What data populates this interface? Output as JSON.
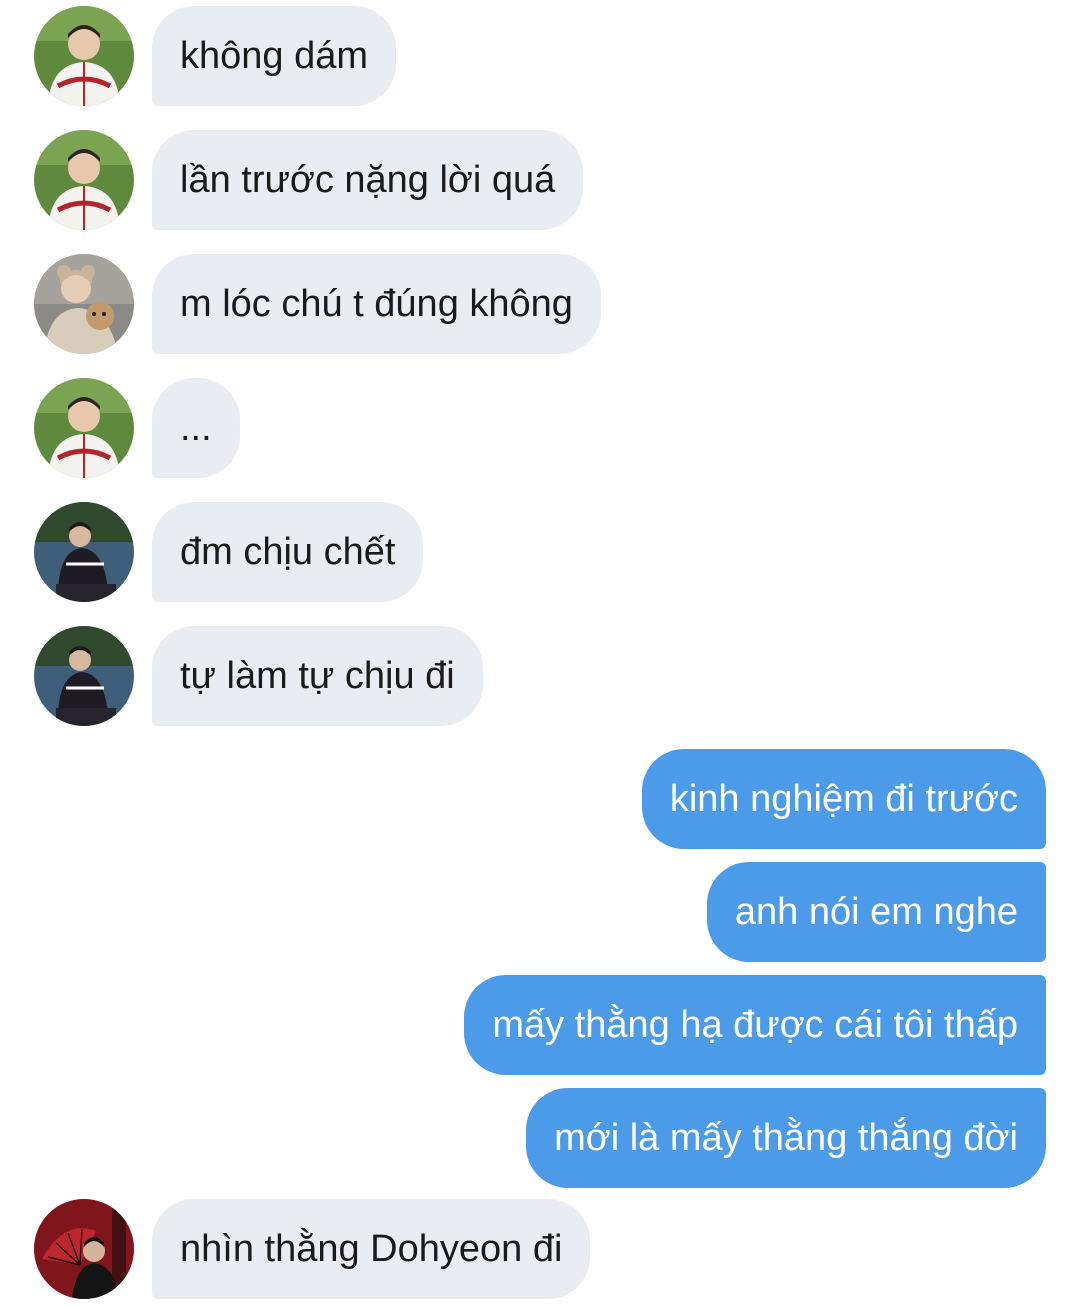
{
  "messages": [
    {
      "side": "incoming",
      "avatar": "avatar-baseball-jersey",
      "text": "không dám"
    },
    {
      "side": "incoming",
      "avatar": "avatar-baseball-jersey",
      "text": "lần trước nặng lời quá"
    },
    {
      "side": "incoming",
      "avatar": "avatar-bear-hat",
      "text": "m lóc chú t đúng không"
    },
    {
      "side": "incoming",
      "avatar": "avatar-baseball-jersey",
      "text": "..."
    },
    {
      "side": "incoming",
      "avatar": "avatar-dark-jersey",
      "text": "đm chịu chết"
    },
    {
      "side": "incoming",
      "avatar": "avatar-dark-jersey",
      "text": "tự làm tự chịu đi"
    },
    {
      "side": "outgoing",
      "text": "kinh nghiệm đi trước"
    },
    {
      "side": "outgoing",
      "text": "anh nói em nghe"
    },
    {
      "side": "outgoing",
      "text": "mấy thằng hạ được cái tôi thấp"
    },
    {
      "side": "outgoing",
      "text": "mới là mấy thằng thắng đời"
    },
    {
      "side": "incoming",
      "avatar": "avatar-red-fan",
      "text": "nhìn thằng Dohyeon đi"
    }
  ],
  "colors": {
    "incoming_bubble": "#e9edf1",
    "outgoing_bubble": "#4c9be8",
    "incoming_text": "#1a1a1a",
    "outgoing_text": "#ffffff"
  }
}
